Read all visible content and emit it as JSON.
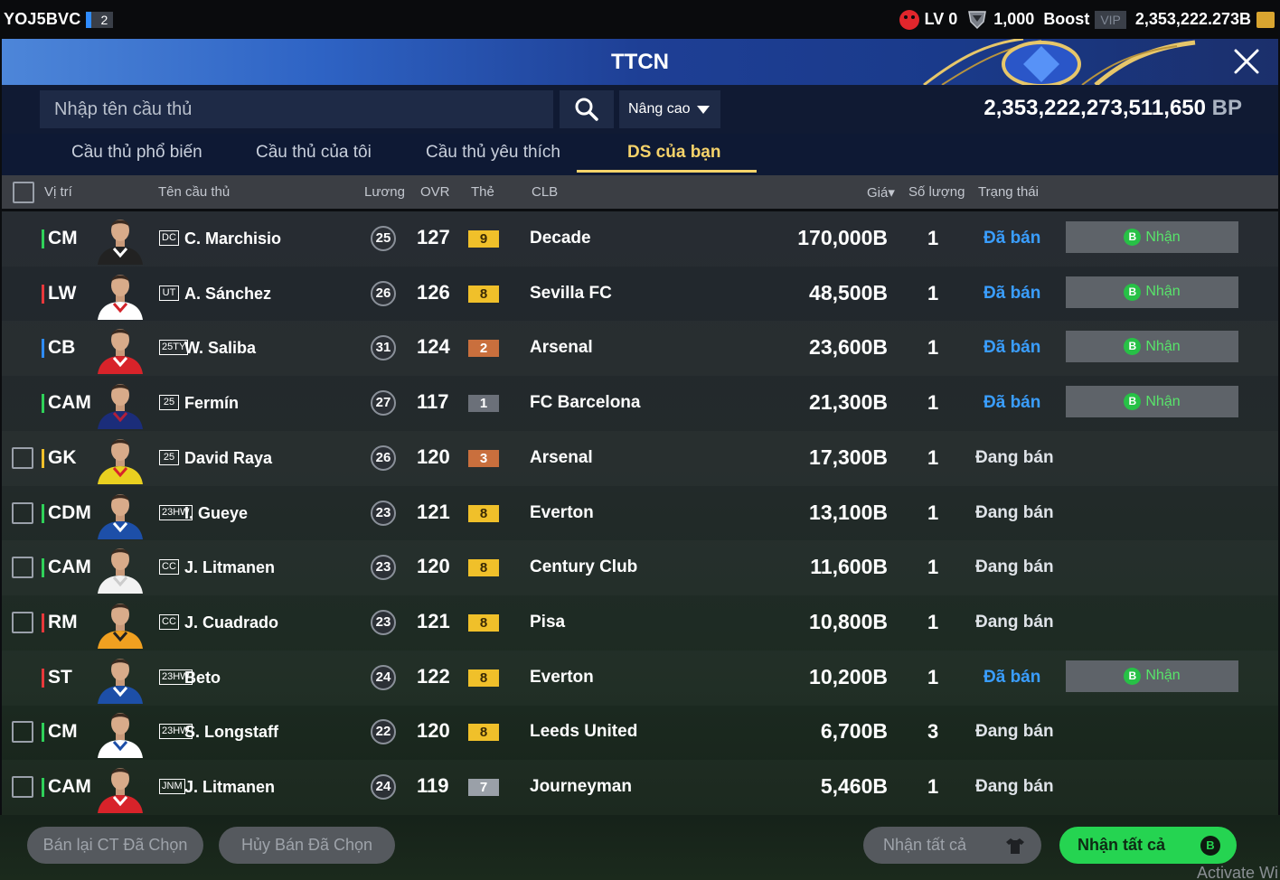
{
  "topbar": {
    "username": "YOJ5BVC",
    "level_badge": "2",
    "lv": "LV 0",
    "tokens": "1,000",
    "boost": "Boost",
    "vip": "VIP",
    "coins": "2,353,222.273B"
  },
  "banner": {
    "title": "TTCN"
  },
  "search": {
    "placeholder": "Nhập tên cầu thủ",
    "advanced_label": "Nâng cao",
    "bp_value": "2,353,222,273,511,650",
    "bp_unit": "BP"
  },
  "tabs": [
    {
      "label": "Cầu thủ phổ biến"
    },
    {
      "label": "Cầu thủ của tôi"
    },
    {
      "label": "Cầu thủ yêu thích"
    },
    {
      "label": "DS của bạn"
    }
  ],
  "table": {
    "headers": {
      "position": "Vị trí",
      "name": "Tên cầu thủ",
      "wage": "Lương",
      "ovr": "OVR",
      "card": "Thẻ",
      "club": "CLB",
      "price": "Giá▾",
      "qty": "Số lượng",
      "status": "Trạng thái"
    },
    "claim_label": "Nhận",
    "coin_glyph": "B",
    "rows": [
      {
        "pos": "CM",
        "pos_color": "#2fd159",
        "season": "DC",
        "name": "C. Marchisio",
        "wage": "25",
        "ovr": "127",
        "card": "9",
        "card_color": "#f0c02a",
        "club": "Decade",
        "price": "170,000B",
        "qty": "1",
        "status": "Đã bán",
        "sold": true,
        "has_checkbox": false,
        "kit": "#222222",
        "kit2": "#ffffff"
      },
      {
        "pos": "LW",
        "pos_color": "#e8383b",
        "season": "UT",
        "name": "A. Sánchez",
        "wage": "26",
        "ovr": "126",
        "card": "8",
        "card_color": "#f0c02a",
        "club": "Sevilla FC",
        "price": "48,500B",
        "qty": "1",
        "status": "Đã bán",
        "sold": true,
        "has_checkbox": false,
        "kit": "#ffffff",
        "kit2": "#d3242b"
      },
      {
        "pos": "CB",
        "pos_color": "#2f8cff",
        "season": "25TY",
        "name": "W. Saliba",
        "wage": "31",
        "ovr": "124",
        "card": "2",
        "card_color": "#c96f3d",
        "club": "Arsenal",
        "price": "23,600B",
        "qty": "1",
        "status": "Đã bán",
        "sold": true,
        "has_checkbox": false,
        "kit": "#d8232a",
        "kit2": "#ffffff"
      },
      {
        "pos": "CAM",
        "pos_color": "#2fd159",
        "season": "25",
        "name": "Fermín",
        "wage": "27",
        "ovr": "117",
        "card": "1",
        "card_color": "#6b7079",
        "club": "FC Barcelona",
        "price": "21,300B",
        "qty": "1",
        "status": "Đã bán",
        "sold": true,
        "has_checkbox": false,
        "kit": "#1b2d7a",
        "kit2": "#b21f3a"
      },
      {
        "pos": "GK",
        "pos_color": "#f0c02a",
        "season": "25",
        "name": "David Raya",
        "wage": "26",
        "ovr": "120",
        "card": "3",
        "card_color": "#c96f3d",
        "club": "Arsenal",
        "price": "17,300B",
        "qty": "1",
        "status": "Đang bán",
        "sold": false,
        "has_checkbox": true,
        "kit": "#e9d020",
        "kit2": "#d8232a"
      },
      {
        "pos": "CDM",
        "pos_color": "#2fd159",
        "season": "23HW",
        "name": "I. Gueye",
        "wage": "23",
        "ovr": "121",
        "card": "8",
        "card_color": "#f0c02a",
        "club": "Everton",
        "price": "13,100B",
        "qty": "1",
        "status": "Đang bán",
        "sold": false,
        "has_checkbox": true,
        "kit": "#1d4fa8",
        "kit2": "#ffffff"
      },
      {
        "pos": "CAM",
        "pos_color": "#2fd159",
        "season": "CC",
        "name": "J. Litmanen",
        "wage": "23",
        "ovr": "120",
        "card": "8",
        "card_color": "#f0c02a",
        "club": "Century Club",
        "price": "11,600B",
        "qty": "1",
        "status": "Đang bán",
        "sold": false,
        "has_checkbox": true,
        "kit": "#f2f2f2",
        "kit2": "#cccccc"
      },
      {
        "pos": "RM",
        "pos_color": "#e8383b",
        "season": "CC",
        "name": "J. Cuadrado",
        "wage": "23",
        "ovr": "121",
        "card": "8",
        "card_color": "#f0c02a",
        "club": "Pisa",
        "price": "10,800B",
        "qty": "1",
        "status": "Đang bán",
        "sold": false,
        "has_checkbox": true,
        "kit": "#f0a020",
        "kit2": "#222222"
      },
      {
        "pos": "ST",
        "pos_color": "#e8383b",
        "season": "23HW",
        "name": "Beto",
        "wage": "24",
        "ovr": "122",
        "card": "8",
        "card_color": "#f0c02a",
        "club": "Everton",
        "price": "10,200B",
        "qty": "1",
        "status": "Đã bán",
        "sold": true,
        "has_checkbox": false,
        "kit": "#1d4fa8",
        "kit2": "#ffffff"
      },
      {
        "pos": "CM",
        "pos_color": "#2fd159",
        "season": "23HW",
        "name": "S. Longstaff",
        "wage": "22",
        "ovr": "120",
        "card": "8",
        "card_color": "#f0c02a",
        "club": "Leeds United",
        "price": "6,700B",
        "qty": "3",
        "status": "Đang bán",
        "sold": false,
        "has_checkbox": true,
        "kit": "#ffffff",
        "kit2": "#1d4fa8"
      },
      {
        "pos": "CAM",
        "pos_color": "#2fd159",
        "season": "JNM",
        "name": "J. Litmanen",
        "wage": "24",
        "ovr": "119",
        "card": "7",
        "card_color": "#9aa0a8",
        "club": "Journeyman",
        "price": "5,460B",
        "qty": "1",
        "status": "Đang bán",
        "sold": false,
        "has_checkbox": true,
        "kit": "#d8232a",
        "kit2": "#ffffff"
      }
    ]
  },
  "footer": {
    "resell_selected": "Bán lại CT Đã Chọn",
    "cancel_selected": "Hủy Bán Đã Chọn",
    "claim_all_gray": "Nhận tất cả",
    "claim_all_green": "Nhận tất cả",
    "watermark": "Activate Wi"
  }
}
